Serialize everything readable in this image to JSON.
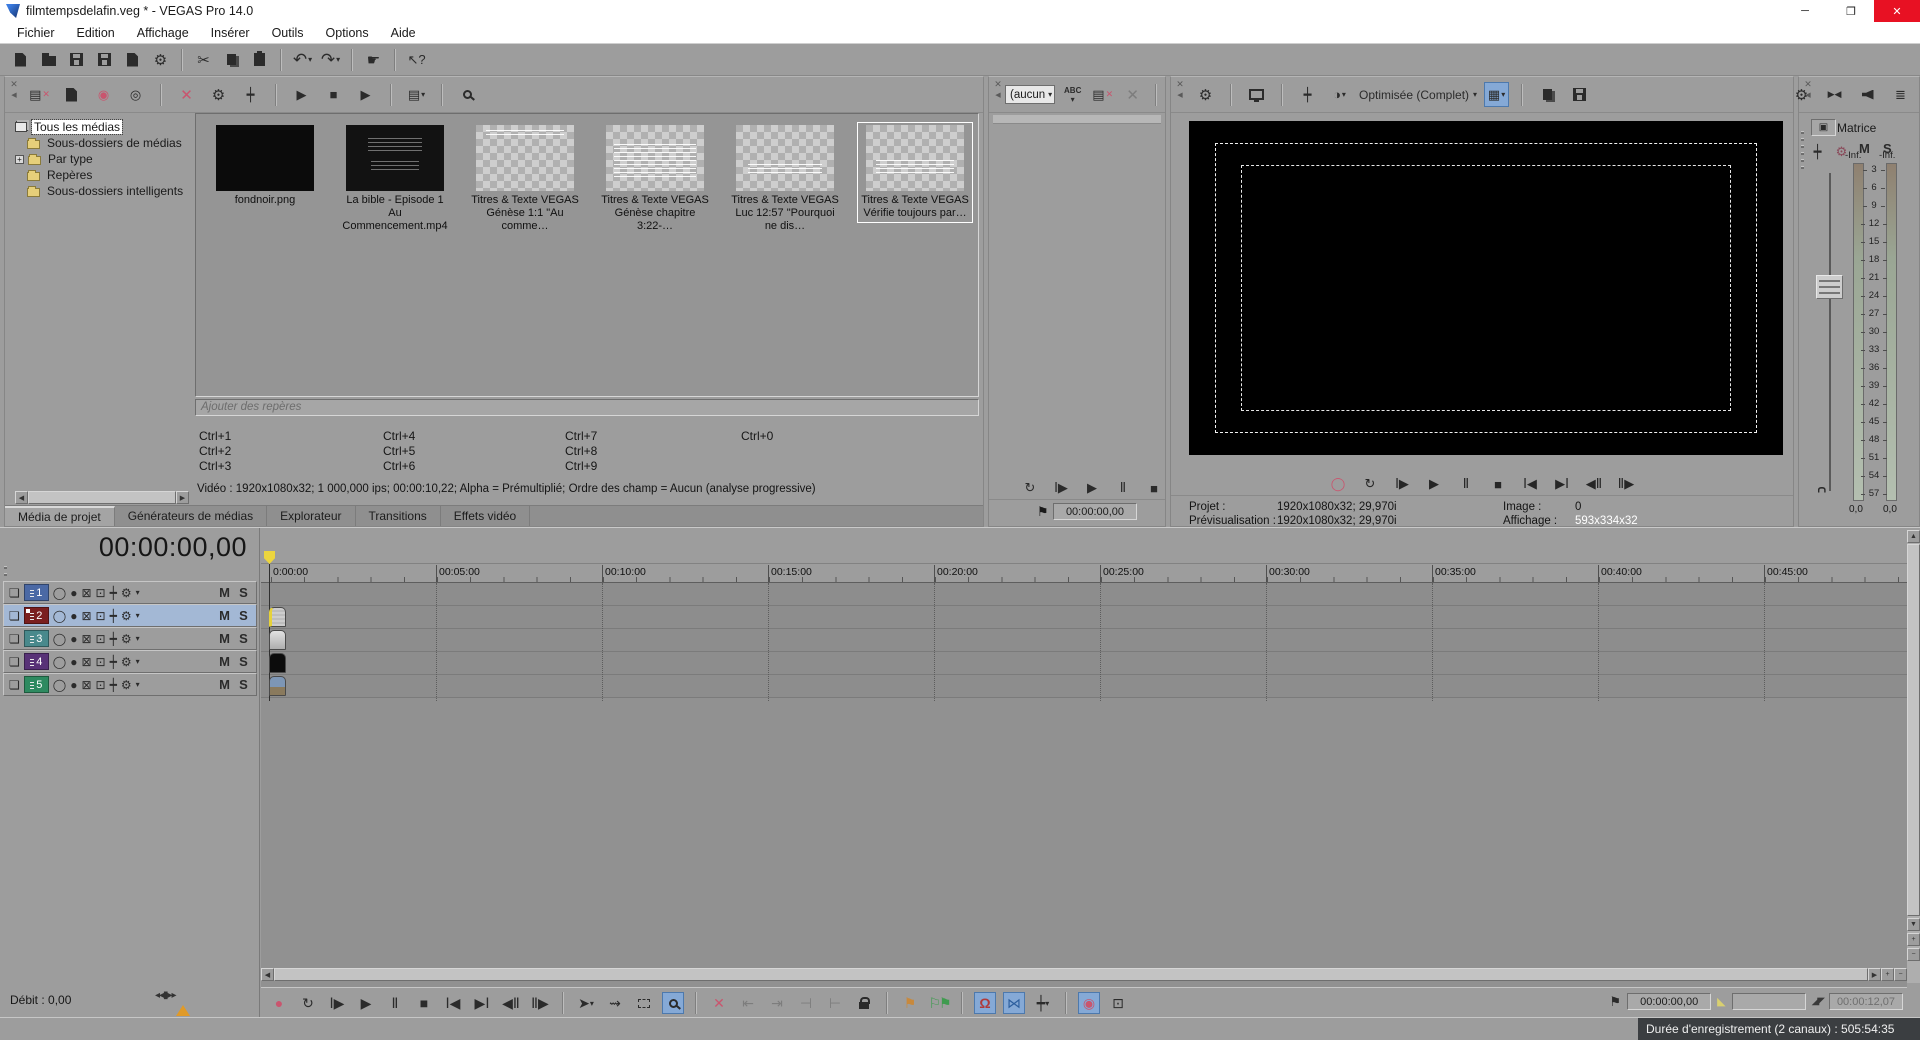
{
  "window": {
    "title": "filmtempsdelafin.veg * - VEGAS Pro 14.0"
  },
  "menu": {
    "items": [
      "Fichier",
      "Edition",
      "Affichage",
      "Insérer",
      "Outils",
      "Options",
      "Aide"
    ]
  },
  "icons": {
    "close": "✕",
    "collapse": "◀",
    "undo": "↶",
    "redo": "↷",
    "cut": "✂",
    "gear": "⚙",
    "caret": "▾",
    "play": "▶",
    "stop": "■",
    "pause": "Ⅱ",
    "record": "●",
    "record_ring": "◯",
    "loop": "↻",
    "play_start": "Ⅰ▶",
    "go_start": "Ⅰ◀",
    "go_end": "▶Ⅰ",
    "frame_back": "◀Ⅱ",
    "frame_fwd": "Ⅱ▶",
    "more": "»",
    "hand": "☛",
    "help": "↖?",
    "list": "▤",
    "grid": "▦",
    "disc": "◎",
    "capture": "◉",
    "half_circle": "◑",
    "split_pin": "┿",
    "crossbox": "⊠",
    "pip": "⊡",
    "group": "❏",
    "circle_a": "◯",
    "circle_b": "●",
    "magnet": "Ω",
    "marker_flag": "⚑",
    "region_flag": "⚐⚑",
    "ripple": "⋈",
    "rec_opts": "◉",
    "trim_a": "⇤",
    "trim_b": "⇥",
    "trim_c": "⊣",
    "trim_d": "⊢",
    "arrow_tool": "➤",
    "envelope_tool": "⇝",
    "abc": "ABC",
    "up": "▲",
    "down": "▼",
    "left": "◀",
    "right": "▶",
    "plus": "+",
    "minus": "−",
    "tri_sel_start": "◣",
    "tri_sel_end": "◢◤",
    "fader_marks": "◂◂▮▸▸",
    "speaker_caret": "▾"
  },
  "colors": {
    "highlight_blue": "#85a9d6",
    "accent_pink": "#c9556e",
    "marker_yellow": "#ecd53e",
    "track1": "#4b69a5",
    "track2": "#7a1f1f",
    "track3": "#49898c",
    "track4": "#583277",
    "track5": "#2e8a60",
    "status_dark": "#3b3e41"
  },
  "project_media": {
    "tree": [
      {
        "label": "Tous les médias"
      },
      {
        "label": "Sous-dossiers de médias"
      },
      {
        "label": "Par type",
        "expander": "+"
      },
      {
        "label": "Repères"
      },
      {
        "label": "Sous-dossiers intelligents"
      }
    ],
    "items": [
      {
        "name": "fondnoir.png"
      },
      {
        "name": "La bible - Episode 1 Au Commencement.mp4"
      },
      {
        "name": "Titres & Texte VEGAS Génèse 1:1 \"Au comme…"
      },
      {
        "name": "Titres & Texte VEGAS Génèse chapitre 3:22-…"
      },
      {
        "name": "Titres & Texte VEGAS Luc 12:57 \"Pourquoi ne dis…"
      },
      {
        "name": "Titres & Texte VEGAS Vérifie toujours par…"
      }
    ],
    "add_marker_placeholder": "Ajouter des repères",
    "shortcuts": [
      [
        "Ctrl+1",
        "Ctrl+4",
        "Ctrl+7",
        "Ctrl+0"
      ],
      [
        "Ctrl+2",
        "Ctrl+5",
        "Ctrl+8",
        ""
      ],
      [
        "Ctrl+3",
        "Ctrl+6",
        "Ctrl+9",
        ""
      ]
    ],
    "media_info": "Vidéo : 1920x1080x32; 1 000,000 ips; 00:00:10,22; Alpha = Prémultiplié; Ordre des champ = Aucun (analyse progressive)",
    "tabs": [
      "Média de projet",
      "Générateurs de médias",
      "Explorateur",
      "Transitions",
      "Effets vidéo"
    ]
  },
  "trimmer": {
    "combo_value": "(aucun",
    "time": "00:00:00,00"
  },
  "preview": {
    "quality": "Optimisée (Complet)",
    "info": {
      "projet_label": "Projet :",
      "projet_value": "1920x1080x32; 29,970i",
      "preview_label": "Prévisualisation :",
      "preview_value": "1920x1080x32; 29,970i",
      "image_label": "Image :",
      "image_value": "0",
      "affichage_label": "Affichage :",
      "affichage_value": "593x334x32"
    }
  },
  "master": {
    "title": "Matrice",
    "inf": "-Inf.",
    "m": "M",
    "s": "S",
    "scale": [
      "3",
      "6",
      "9",
      "12",
      "15",
      "18",
      "21",
      "24",
      "27",
      "30",
      "33",
      "36",
      "39",
      "42",
      "45",
      "48",
      "51",
      "54",
      "57"
    ],
    "values": [
      "0,0",
      "0,0"
    ]
  },
  "timeline": {
    "time": "00:00:00,00",
    "ruler": [
      "0:00:00",
      "00:05:00",
      "00:10:00",
      "00:15:00",
      "00:20:00",
      "00:25:00",
      "00:30:00",
      "00:35:00",
      "00:40:00",
      "00:45:00"
    ],
    "tracks": [
      {
        "num": "1"
      },
      {
        "num": "2"
      },
      {
        "num": "3"
      },
      {
        "num": "4"
      },
      {
        "num": "5"
      }
    ],
    "mute": "M",
    "solo": "S"
  },
  "transport_right": {
    "cursor_time": "00:00:00,00",
    "selection_start": "",
    "selection_end": "00:00:12,07"
  },
  "status": {
    "debit": "Débit : 0,00",
    "record_duration": "Durée d'enregistrement (2 canaux) : 505:54:35"
  }
}
